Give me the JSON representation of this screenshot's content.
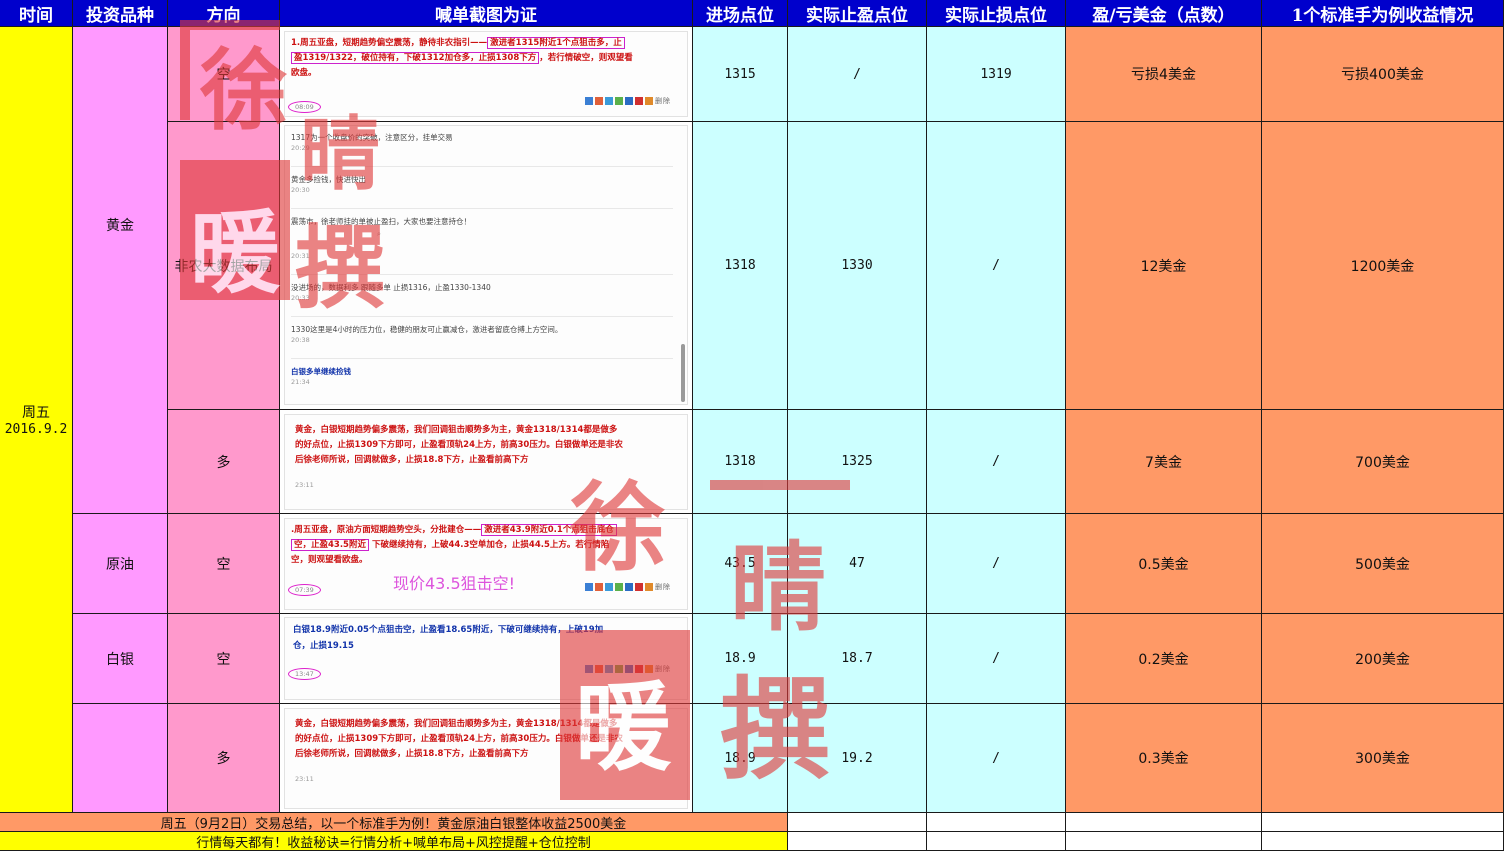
{
  "headers": [
    "时间",
    "投资品种",
    "方向",
    "喊单截图为证",
    "进场点位",
    "实际止盈点位",
    "实际止损点位",
    "盈/亏美金（点数）",
    "1个标准手为例收益情况"
  ],
  "date": {
    "weekday": "周五",
    "date": "2016.9.2"
  },
  "instruments": {
    "gold": "黄金",
    "oil": "原油",
    "silver": "白银"
  },
  "rows": [
    {
      "direction": "空",
      "entry": "1315",
      "tp": "/",
      "sl": "1319",
      "pl": "亏损4美金",
      "result": "亏损400美金"
    },
    {
      "direction": "非农大数据布局",
      "entry": "1318",
      "tp": "1330",
      "sl": "/",
      "pl": "12美金",
      "result": "1200美金"
    },
    {
      "direction": "多",
      "entry": "1318",
      "tp": "1325",
      "sl": "/",
      "pl": "7美金",
      "result": "700美金"
    },
    {
      "direction": "空",
      "entry": "43.5",
      "tp": "47",
      "sl": "/",
      "pl": "0.5美金",
      "result": "500美金"
    },
    {
      "direction": "空",
      "entry": "18.9",
      "tp": "18.7",
      "sl": "/",
      "pl": "0.2美金",
      "result": "200美金"
    },
    {
      "direction": "多",
      "entry": "18.9",
      "tp": "19.2",
      "sl": "/",
      "pl": "0.3美金",
      "result": "300美金"
    }
  ],
  "shots": {
    "s1": {
      "a": "1.周五亚盘，短期趋势偏空震荡，静待非农指引——",
      "b": "激进者1315附近1个点狙击多，止",
      "c": "盈1319/1322，破位持有，下破1312加仓多，止损1308下方",
      "d": "，若行情破空，则观望看",
      "e": "欧盘。",
      "time": "08:09"
    },
    "s2": [
      {
        "text": "1317为一个收盘价的突破，注意区分，挂单交易",
        "time": "20:29"
      },
      {
        "text": "黄金多捡钱，快进快出",
        "time": "20:30"
      },
      {
        "text": "震荡市，徐老师挂的单被止盈扫，大家也要注意持仓！",
        "time": "20:31"
      },
      {
        "text": "没进场的，数据利多 跟随多单 止损1316，止盈1330-1340",
        "time": "20:33"
      },
      {
        "text": "1330这里是4小时的压力位，稳健的朋友可止赢减仓，激进者留底仓搏上方空间。",
        "time": "20:38"
      },
      {
        "text": "白银多单继续捡钱",
        "time": "21:34"
      }
    ],
    "s3": {
      "l1": "黄金，白银短期趋势偏多震荡，我们回调狙击顺势多为主，黄金1318/1314都是做多",
      "l2": "的好点位，止损1309下方即可，止盈看顶轨24上方，前高30压力。白银做单还是非农",
      "l3": "后徐老师所说，回调就做多，止损18.8下方，止盈看前高下方",
      "time": "23:11"
    },
    "s4": {
      "a": ".周五亚盘，原油方面短期趋势空头，分批建仓——",
      "b": "激进者43.9附近0.1个点狙击底仓",
      "c": "空，止盈43.5附近",
      "d": "下破继续持有，上破44.3空单加仓，止损44.5上方。若行情陷",
      "e": "空，则观望看欧盘。",
      "note": "现价43.5狙击空!",
      "time": "07:39"
    },
    "s5": {
      "l1": "白银18.9附近0.05个点狙击空，止盈看18.65附近，下破可继续持有，上破19加",
      "l2": "仓，止损19.15",
      "time": "13:47"
    },
    "s6": {
      "l1": "黄金，白银短期趋势偏多震荡，我们回调狙击顺势多为主，黄金1318/1314都是做多",
      "l2": "的好点位，止损1309下方即可，止盈看顶轨24上方，前高30压力。白银做单还是非农",
      "l3": "后徐老师所说，回调就做多，止损18.8下方，止盈看前高下方",
      "time": "23:11"
    },
    "tools_label": "删除"
  },
  "footer": {
    "summary": "周五（9月2日）交易总结，以一个标准手为例！黄金原油白银整体收益2500美金",
    "slogan": "行情每天都有！收益秘诀=行情分析+喊单布局+风控提醒+仓位控制"
  },
  "watermark": {
    "chars": [
      "徐",
      "晴",
      "暖",
      "撰"
    ]
  },
  "colors": {
    "header": "#0000cc",
    "yellow": "#ffff00",
    "pink": "#ff99ff",
    "rose": "#ff99cc",
    "cyan": "#ccffff",
    "orange": "#ff9966",
    "watermark": "#e03a3a"
  }
}
